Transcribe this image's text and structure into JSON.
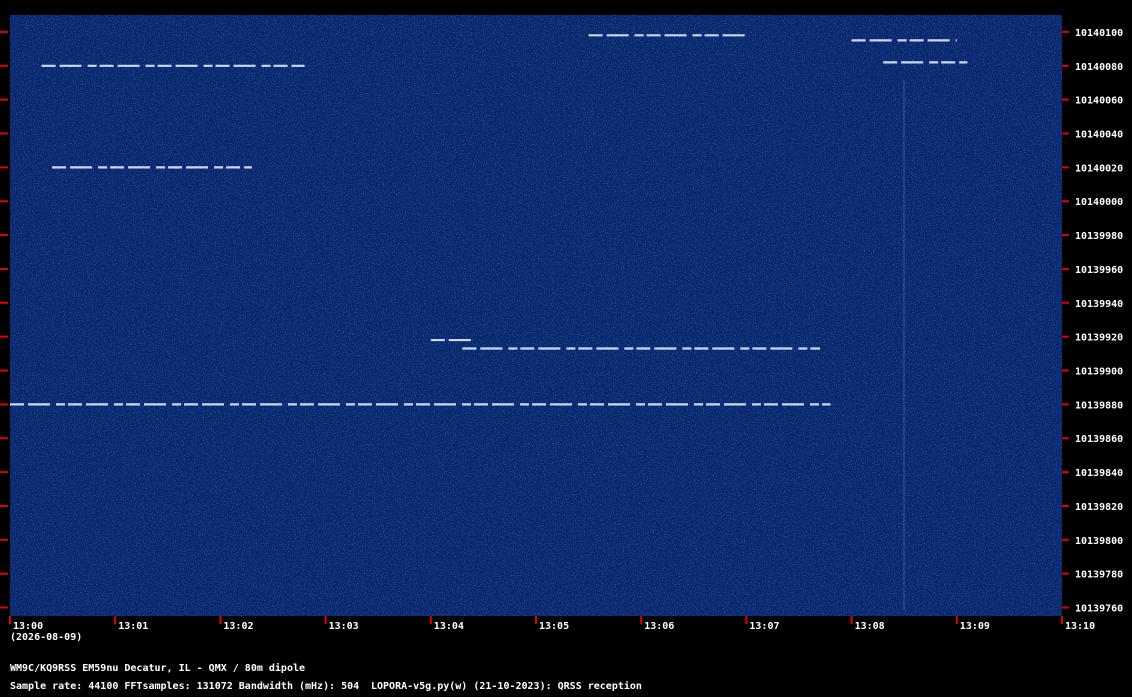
{
  "chart_data": {
    "type": "heatmap",
    "title": "",
    "xlabel": "",
    "ylabel": "",
    "x_tick_labels": [
      "13:00",
      "13:01",
      "13:02",
      "13:03",
      "13:04",
      "13:05",
      "13:06",
      "13:07",
      "13:08",
      "13:09",
      "13:10"
    ],
    "x_range": [
      "13:00",
      "13:10"
    ],
    "date_label": "(2026-08-09)",
    "y_tick_labels": [
      "10140100",
      "10140080",
      "10140060",
      "10140040",
      "10140020",
      "10140000",
      "10139980",
      "10139960",
      "10139940",
      "10139920",
      "10139900",
      "10139880",
      "10139860",
      "10139840",
      "10139820",
      "10139800",
      "10139780",
      "10139760"
    ],
    "y_range": [
      10139755,
      10140110
    ],
    "traces": [
      {
        "freq": 10139880,
        "start": "13:00",
        "end": "13:07.8"
      },
      {
        "freq": 10139918,
        "start": "13:04",
        "end": "13:04.4"
      },
      {
        "freq": 10139913,
        "start": "13:04.3",
        "end": "13:07.7"
      },
      {
        "freq": 10140020,
        "start": "13:00.4",
        "end": "13:02.3"
      },
      {
        "freq": 10140080,
        "start": "13:00.3",
        "end": "13:02.8"
      },
      {
        "freq": 10140098,
        "start": "13:05.5",
        "end": "13:07.0"
      },
      {
        "freq": 10140095,
        "start": "13:08.0",
        "end": "13:09.0"
      },
      {
        "freq": 10140082,
        "start": "13:08.3",
        "end": "13:09.1"
      }
    ],
    "grid": false,
    "colors": {
      "background": "#07266b",
      "signal": "#c8dcff",
      "tick": "#e00000",
      "text": "#ffffff"
    }
  },
  "footer": {
    "station": "WM9C/KQ9RSS EM59nu Decatur, IL - QMX / 80m dipole",
    "params": "Sample rate: 44100    FFTsamples: 131072    Bandwidth (mHz): 504",
    "software": "LOPORA-v5g.py(w) (21-10-2023): QRSS reception"
  }
}
